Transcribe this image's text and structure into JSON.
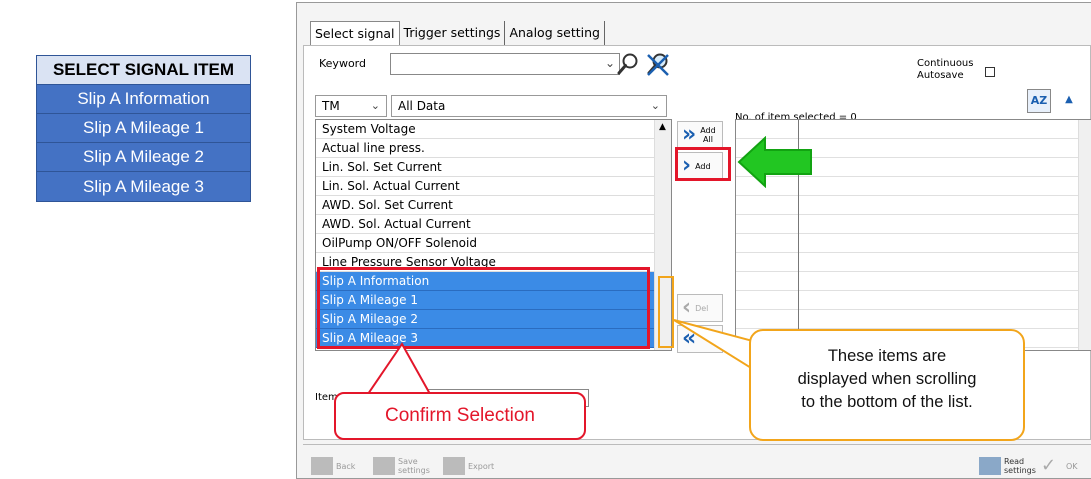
{
  "signal_table": {
    "header": "SELECT SIGNAL ITEM",
    "items": [
      "Slip A Information",
      "Slip A Mileage 1",
      "Slip A Mileage 2",
      "Slip A Mileage 3"
    ]
  },
  "window": {
    "tabs": [
      "Select signal",
      "Trigger settings",
      "Analog setting"
    ],
    "keyword_label": "Keyword",
    "keyword_value": "",
    "continuous_autosave_label": [
      "Continuous",
      "Autosave"
    ],
    "category_select": "TM",
    "filter_select": "All Data",
    "signal_list": [
      {
        "label": "System Voltage",
        "selected": false
      },
      {
        "label": "Actual line press.",
        "selected": false
      },
      {
        "label": "Lin. Sol. Set Current",
        "selected": false
      },
      {
        "label": "Lin. Sol. Actual Current",
        "selected": false
      },
      {
        "label": "AWD. Sol. Set Current",
        "selected": false
      },
      {
        "label": "AWD. Sol. Actual Current",
        "selected": false
      },
      {
        "label": "OilPump ON/OFF Solenoid",
        "selected": false
      },
      {
        "label": "Line Pressure Sensor Voltage",
        "selected": false
      },
      {
        "label": "Slip A Information",
        "selected": true
      },
      {
        "label": "Slip A Mileage 1",
        "selected": true
      },
      {
        "label": "Slip A Mileage 2",
        "selected": true
      },
      {
        "label": "Slip A Mileage 3",
        "selected": true
      }
    ],
    "buttons": {
      "add_all": [
        "Add",
        "All"
      ],
      "add": "Add",
      "del": "Del"
    },
    "selected_count_text": "No. of item selected = 0",
    "item_info_label": "Item Info",
    "bottom_buttons": {
      "back": "Back",
      "save_settings": [
        "Save",
        "settings"
      ],
      "export": "Export",
      "read_settings": [
        "Read",
        "settings"
      ],
      "ok": "OK"
    }
  },
  "annotations": {
    "confirm_selection": "Confirm Selection",
    "scroll_note": [
      "These items are",
      "displayed when scrolling",
      "to the bottom of the list."
    ],
    "highlight_color": "#e3162a",
    "note_color": "#f2a51b",
    "arrow_color": "#22c622"
  }
}
